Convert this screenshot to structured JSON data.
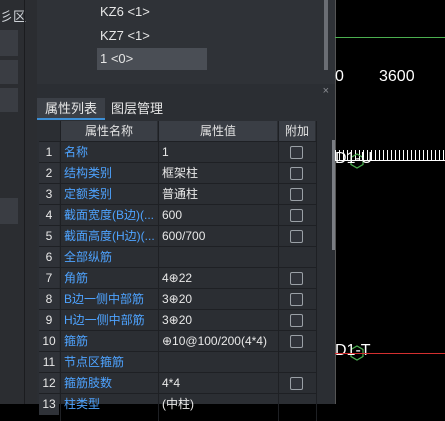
{
  "left_panel": {
    "label": "彡区"
  },
  "top_list": {
    "items": [
      "KZ6 <1>",
      "KZ7 <1>",
      "1 <0>"
    ]
  },
  "props": {
    "close": "×",
    "tabs": [
      {
        "label": "属性列表",
        "active": true
      },
      {
        "label": "图层管理",
        "active": false
      }
    ],
    "headers": {
      "name": "属性名称",
      "value": "属性值",
      "extra": "附加"
    },
    "rows": [
      {
        "num": "1",
        "name": "名称",
        "value": "1"
      },
      {
        "num": "2",
        "name": "结构类别",
        "value": "框架柱"
      },
      {
        "num": "3",
        "name": "定额类别",
        "value": "普通柱"
      },
      {
        "num": "4",
        "name": "截面宽度(B边)(...",
        "value": "600"
      },
      {
        "num": "5",
        "name": "截面高度(H边)(...",
        "value": "600/700"
      },
      {
        "num": "6",
        "name": "全部纵筋",
        "value": ""
      },
      {
        "num": "7",
        "name": "角筋",
        "value": "4⊕22"
      },
      {
        "num": "8",
        "name": "B边一侧中部筋",
        "value": "3⊕20"
      },
      {
        "num": "9",
        "name": "H边一侧中部筋",
        "value": "3⊕20"
      },
      {
        "num": "10",
        "name": "箍筋",
        "value": "⊕10@100/200(4*4)"
      },
      {
        "num": "11",
        "name": "节点区箍筋",
        "value": ""
      },
      {
        "num": "12",
        "name": "箍筋肢数",
        "value": "4*4"
      },
      {
        "num": "13",
        "name": "柱类型",
        "value": "(中柱)"
      }
    ]
  },
  "cad": {
    "dim_0": "0",
    "dim_3600": "3600",
    "label_top": "D1-U",
    "label_bottom": "D1-T"
  },
  "colors": {
    "accent": "#3c8fd6",
    "link": "#4ea3ff",
    "red": "#d32f2f",
    "green": "#4caf50"
  }
}
